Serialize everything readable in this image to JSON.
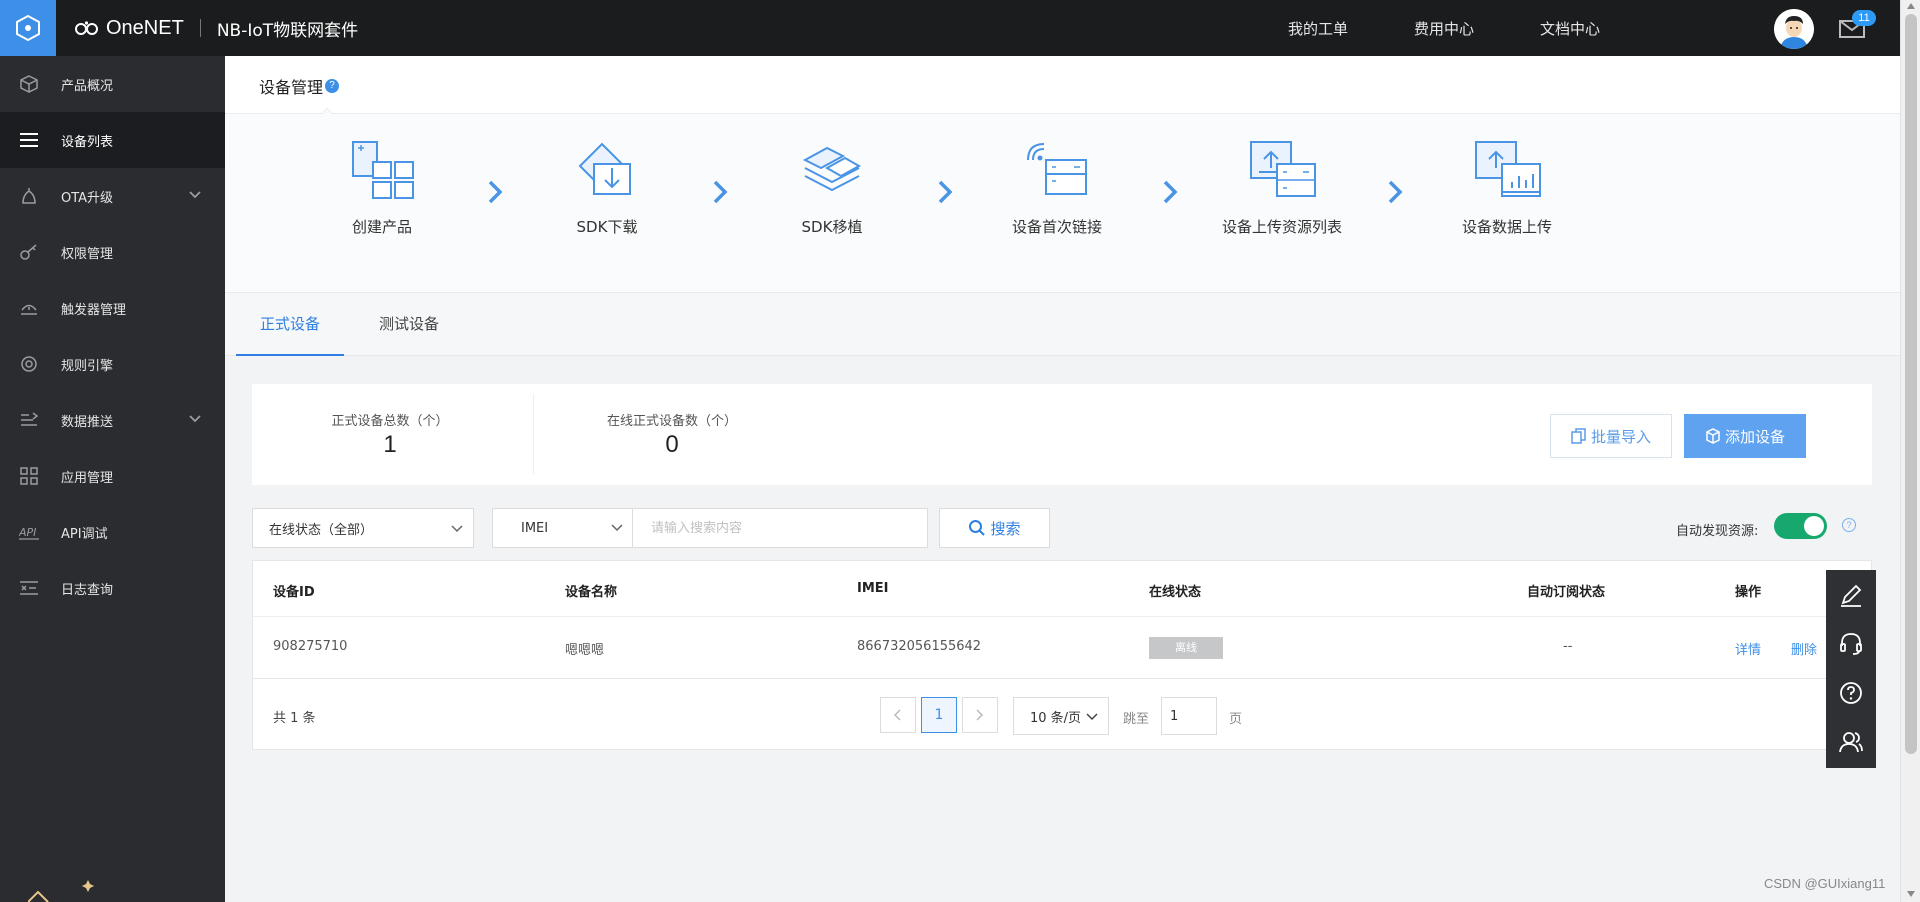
{
  "topbar": {
    "brand": "OneNET",
    "product": "NB-IoT物联网套件",
    "links": [
      "我的工单",
      "费用中心",
      "文档中心"
    ],
    "mail_count": "11"
  },
  "sidebar": {
    "items": [
      {
        "label": "产品概况",
        "icon": "cube-icon"
      },
      {
        "label": "设备列表",
        "icon": "list-icon",
        "active": true
      },
      {
        "label": "OTA升级",
        "icon": "ota-icon",
        "expandable": true
      },
      {
        "label": "权限管理",
        "icon": "key-icon"
      },
      {
        "label": "触发器管理",
        "icon": "trigger-icon"
      },
      {
        "label": "规则引擎",
        "icon": "rule-engine-icon"
      },
      {
        "label": "数据推送",
        "icon": "data-push-icon",
        "expandable": true
      },
      {
        "label": "应用管理",
        "icon": "apps-grid-icon"
      },
      {
        "label": "API调试",
        "icon": "api-icon"
      },
      {
        "label": "日志查询",
        "icon": "log-icon"
      }
    ]
  },
  "page": {
    "title": "设备管理",
    "help": "?"
  },
  "steps": [
    "创建产品",
    "SDK下载",
    "SDK移植",
    "设备首次链接",
    "设备上传资源列表",
    "设备数据上传"
  ],
  "tabs": [
    "正式设备",
    "测试设备"
  ],
  "stats": {
    "total_label": "正式设备总数（个）",
    "total_value": "1",
    "online_label": "在线正式设备数（个）",
    "online_value": "0"
  },
  "actions": {
    "import": "批量导入",
    "add": "添加设备"
  },
  "filters": {
    "status_select": "在线状态（全部）",
    "search_type": "IMEI",
    "search_placeholder": "请输入搜索内容",
    "search_button": "搜索",
    "auto_discover_label": "自动发现资源:",
    "auto_discover_on": true,
    "help": "?"
  },
  "table": {
    "headers": [
      "设备ID",
      "设备名称",
      "IMEI",
      "在线状态",
      "自动订阅状态",
      "操作"
    ],
    "rows": [
      {
        "id": "908275710",
        "name": "嗯嗯嗯",
        "imei": "866732056155642",
        "status": "离线",
        "subscribe": "--",
        "actions": [
          "详情",
          "删除"
        ]
      }
    ]
  },
  "pagination": {
    "total": "共 1 条",
    "current": "1",
    "page_size": "10 条/页",
    "jump_prefix": "跳至",
    "jump_value": "1",
    "jump_suffix": "页"
  },
  "watermark": "CSDN @GUIxiang11",
  "colors": {
    "accent": "#3d8fe8",
    "topbar": "#1b1c1e",
    "sidebar": "#2a2c30",
    "toggle_on": "#17a86e",
    "offline_tag": "#c6c7c9"
  }
}
